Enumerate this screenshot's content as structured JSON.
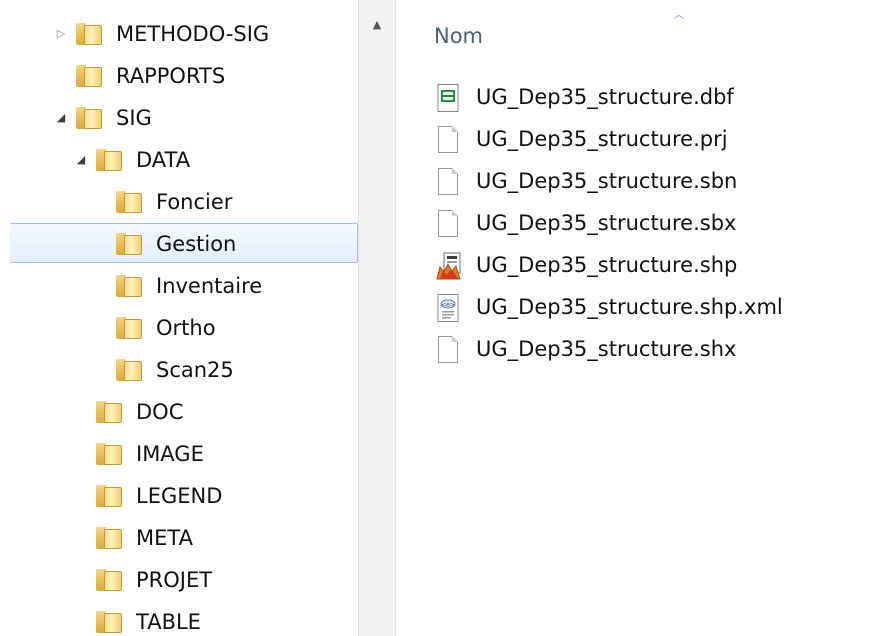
{
  "nav": {
    "items": [
      {
        "label": "METHODO-SIG",
        "expander": "collapsed",
        "icon": "folder-icon"
      },
      {
        "label": "RAPPORTS",
        "expander": "none",
        "icon": "folder-icon"
      },
      {
        "label": "SIG",
        "expander": "expanded",
        "icon": "folder-icon"
      },
      {
        "label": "DATA",
        "expander": "expanded",
        "icon": "folder-icon"
      },
      {
        "label": "Foncier",
        "expander": "none",
        "icon": "folder-icon"
      },
      {
        "label": "Gestion",
        "expander": "none",
        "icon": "folder-icon",
        "selected": true
      },
      {
        "label": "Inventaire",
        "expander": "none",
        "icon": "folder-icon"
      },
      {
        "label": "Ortho",
        "expander": "none",
        "icon": "folder-icon"
      },
      {
        "label": "Scan25",
        "expander": "none",
        "icon": "folder-icon"
      },
      {
        "label": "DOC",
        "expander": "none",
        "icon": "folder-icon"
      },
      {
        "label": "IMAGE",
        "expander": "none",
        "icon": "folder-icon"
      },
      {
        "label": "LEGEND",
        "expander": "none",
        "icon": "folder-icon"
      },
      {
        "label": "META",
        "expander": "none",
        "icon": "folder-icon"
      },
      {
        "label": "PROJET",
        "expander": "none",
        "icon": "folder-icon"
      },
      {
        "label": "TABLE",
        "expander": "none",
        "icon": "folder-icon"
      }
    ]
  },
  "content": {
    "column_header": "Nom",
    "sort_indicator": "ascending",
    "files": [
      {
        "name": "UG_Dep35_structure.dbf",
        "icon": "dbf-file-icon"
      },
      {
        "name": "UG_Dep35_structure.prj",
        "icon": "blank-file-icon"
      },
      {
        "name": "UG_Dep35_structure.sbn",
        "icon": "blank-file-icon"
      },
      {
        "name": "UG_Dep35_structure.sbx",
        "icon": "blank-file-icon"
      },
      {
        "name": "UG_Dep35_structure.shp",
        "icon": "shapefile-icon"
      },
      {
        "name": "UG_Dep35_structure.shp.xml",
        "icon": "xml-file-icon"
      },
      {
        "name": "UG_Dep35_structure.shx",
        "icon": "blank-file-icon"
      }
    ]
  },
  "colors": {
    "selection_border": "#9cc3ea",
    "selection_fill": "#e3eefb",
    "header_text": "#4c607a",
    "folder": "#f1cf6c"
  }
}
